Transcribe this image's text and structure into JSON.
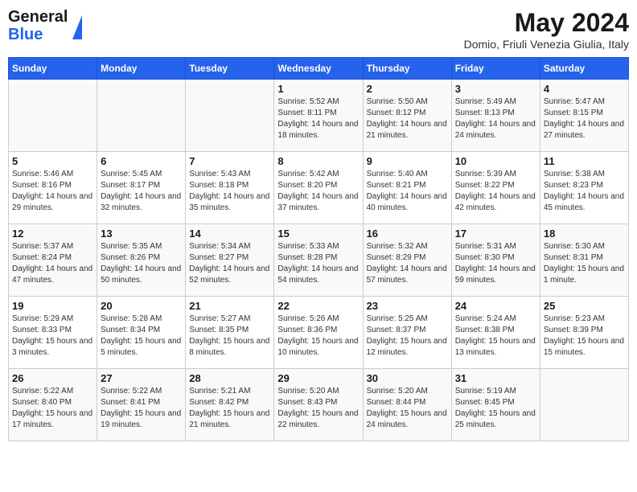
{
  "header": {
    "logo_line1": "General",
    "logo_line2": "Blue",
    "month_year": "May 2024",
    "location": "Domio, Friuli Venezia Giulia, Italy"
  },
  "days_of_week": [
    "Sunday",
    "Monday",
    "Tuesday",
    "Wednesday",
    "Thursday",
    "Friday",
    "Saturday"
  ],
  "weeks": [
    [
      {
        "day": "",
        "info": ""
      },
      {
        "day": "",
        "info": ""
      },
      {
        "day": "",
        "info": ""
      },
      {
        "day": "1",
        "info": "Sunrise: 5:52 AM\nSunset: 8:11 PM\nDaylight: 14 hours and 18 minutes."
      },
      {
        "day": "2",
        "info": "Sunrise: 5:50 AM\nSunset: 8:12 PM\nDaylight: 14 hours and 21 minutes."
      },
      {
        "day": "3",
        "info": "Sunrise: 5:49 AM\nSunset: 8:13 PM\nDaylight: 14 hours and 24 minutes."
      },
      {
        "day": "4",
        "info": "Sunrise: 5:47 AM\nSunset: 8:15 PM\nDaylight: 14 hours and 27 minutes."
      }
    ],
    [
      {
        "day": "5",
        "info": "Sunrise: 5:46 AM\nSunset: 8:16 PM\nDaylight: 14 hours and 29 minutes."
      },
      {
        "day": "6",
        "info": "Sunrise: 5:45 AM\nSunset: 8:17 PM\nDaylight: 14 hours and 32 minutes."
      },
      {
        "day": "7",
        "info": "Sunrise: 5:43 AM\nSunset: 8:18 PM\nDaylight: 14 hours and 35 minutes."
      },
      {
        "day": "8",
        "info": "Sunrise: 5:42 AM\nSunset: 8:20 PM\nDaylight: 14 hours and 37 minutes."
      },
      {
        "day": "9",
        "info": "Sunrise: 5:40 AM\nSunset: 8:21 PM\nDaylight: 14 hours and 40 minutes."
      },
      {
        "day": "10",
        "info": "Sunrise: 5:39 AM\nSunset: 8:22 PM\nDaylight: 14 hours and 42 minutes."
      },
      {
        "day": "11",
        "info": "Sunrise: 5:38 AM\nSunset: 8:23 PM\nDaylight: 14 hours and 45 minutes."
      }
    ],
    [
      {
        "day": "12",
        "info": "Sunrise: 5:37 AM\nSunset: 8:24 PM\nDaylight: 14 hours and 47 minutes."
      },
      {
        "day": "13",
        "info": "Sunrise: 5:35 AM\nSunset: 8:26 PM\nDaylight: 14 hours and 50 minutes."
      },
      {
        "day": "14",
        "info": "Sunrise: 5:34 AM\nSunset: 8:27 PM\nDaylight: 14 hours and 52 minutes."
      },
      {
        "day": "15",
        "info": "Sunrise: 5:33 AM\nSunset: 8:28 PM\nDaylight: 14 hours and 54 minutes."
      },
      {
        "day": "16",
        "info": "Sunrise: 5:32 AM\nSunset: 8:29 PM\nDaylight: 14 hours and 57 minutes."
      },
      {
        "day": "17",
        "info": "Sunrise: 5:31 AM\nSunset: 8:30 PM\nDaylight: 14 hours and 59 minutes."
      },
      {
        "day": "18",
        "info": "Sunrise: 5:30 AM\nSunset: 8:31 PM\nDaylight: 15 hours and 1 minute."
      }
    ],
    [
      {
        "day": "19",
        "info": "Sunrise: 5:29 AM\nSunset: 8:33 PM\nDaylight: 15 hours and 3 minutes."
      },
      {
        "day": "20",
        "info": "Sunrise: 5:28 AM\nSunset: 8:34 PM\nDaylight: 15 hours and 5 minutes."
      },
      {
        "day": "21",
        "info": "Sunrise: 5:27 AM\nSunset: 8:35 PM\nDaylight: 15 hours and 8 minutes."
      },
      {
        "day": "22",
        "info": "Sunrise: 5:26 AM\nSunset: 8:36 PM\nDaylight: 15 hours and 10 minutes."
      },
      {
        "day": "23",
        "info": "Sunrise: 5:25 AM\nSunset: 8:37 PM\nDaylight: 15 hours and 12 minutes."
      },
      {
        "day": "24",
        "info": "Sunrise: 5:24 AM\nSunset: 8:38 PM\nDaylight: 15 hours and 13 minutes."
      },
      {
        "day": "25",
        "info": "Sunrise: 5:23 AM\nSunset: 8:39 PM\nDaylight: 15 hours and 15 minutes."
      }
    ],
    [
      {
        "day": "26",
        "info": "Sunrise: 5:22 AM\nSunset: 8:40 PM\nDaylight: 15 hours and 17 minutes."
      },
      {
        "day": "27",
        "info": "Sunrise: 5:22 AM\nSunset: 8:41 PM\nDaylight: 15 hours and 19 minutes."
      },
      {
        "day": "28",
        "info": "Sunrise: 5:21 AM\nSunset: 8:42 PM\nDaylight: 15 hours and 21 minutes."
      },
      {
        "day": "29",
        "info": "Sunrise: 5:20 AM\nSunset: 8:43 PM\nDaylight: 15 hours and 22 minutes."
      },
      {
        "day": "30",
        "info": "Sunrise: 5:20 AM\nSunset: 8:44 PM\nDaylight: 15 hours and 24 minutes."
      },
      {
        "day": "31",
        "info": "Sunrise: 5:19 AM\nSunset: 8:45 PM\nDaylight: 15 hours and 25 minutes."
      },
      {
        "day": "",
        "info": ""
      }
    ]
  ]
}
